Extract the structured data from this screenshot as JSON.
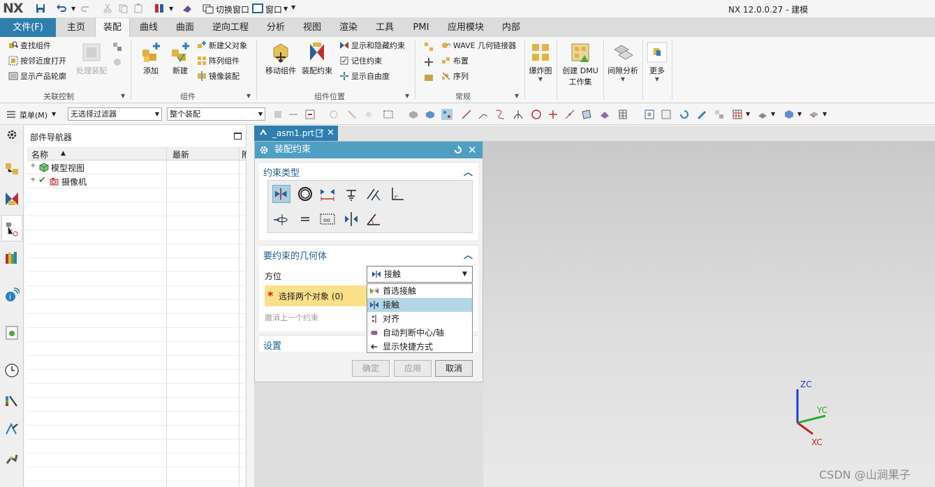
{
  "app": {
    "logo": "NX",
    "title": "NX 12.0.0.27 - 建模",
    "switch_window": "切换窗口",
    "window_menu": "窗口"
  },
  "tabs": [
    "文件(F)",
    "主页",
    "装配",
    "曲线",
    "曲面",
    "逆向工程",
    "分析",
    "视图",
    "渲染",
    "工具",
    "PMI",
    "应用模块",
    "内部"
  ],
  "ribbon": {
    "assoc_control": {
      "label": "关联控制",
      "find_component": "查找组件",
      "open_by_proximity": "按邻近度打开",
      "show_product_outline": "显示产品轮廓",
      "process_assembly": "处理装配"
    },
    "component": {
      "label": "组件",
      "add": "添加",
      "new": "新建",
      "new_parent": "新建父对象",
      "array_component": "阵列组件",
      "mirror_assembly": "镜像装配"
    },
    "component_position": {
      "label": "组件位置",
      "move_component": "移动组件",
      "assembly_constraint": "装配约束",
      "show_hide_constraints": "显示和隐藏约束",
      "remember_constraints": "记住约束",
      "show_dof": "显示自由度"
    },
    "general": {
      "label": "常规",
      "wave_linker": "WAVE 几何链接器",
      "arrangement": "布置",
      "sequence": "序列"
    },
    "exploded_view": "爆炸图",
    "create_dmu": "创建 DMU\n工作集",
    "create_dmu_line1": "创建 DMU",
    "create_dmu_line2": "工作集",
    "clearance_analysis": "间隙分析",
    "more": "更多"
  },
  "selection_bar": {
    "menu": "菜单(M)",
    "filter": "无选择过滤器",
    "scope": "整个装配"
  },
  "navigator": {
    "title": "部件导航器",
    "columns": [
      "名称",
      "最新",
      "附"
    ],
    "rows": [
      {
        "label": "模型视图"
      },
      {
        "label": "摄像机"
      }
    ]
  },
  "doc_tab": {
    "label": "_asm1.prt"
  },
  "dialog": {
    "title": "装配约束",
    "constraint_type": "约束类型",
    "geometry_section": "要约束的几何体",
    "orientation_label": "方位",
    "orientation_value": "接触",
    "select_objects": "选择两个对象 (0)",
    "undo_last": "撤消上一个约束",
    "settings": "设置",
    "ok": "确定",
    "apply": "应用",
    "cancel": "取消"
  },
  "orientation_options": [
    {
      "label": "首选接触",
      "icon": "prefer-touch-icon"
    },
    {
      "label": "接触",
      "icon": "touch-icon",
      "selected": true
    },
    {
      "label": "对齐",
      "icon": "align-icon"
    },
    {
      "label": "自动判断中心/轴",
      "icon": "infer-axis-icon"
    },
    {
      "label": "显示快捷方式",
      "icon": "shortcut-icon"
    }
  ],
  "triad": {
    "zc": "ZC",
    "yc": "YC",
    "xc": "XC"
  },
  "watermark": "CSDN @山涧果子",
  "colors": {
    "accent": "#2e7fb0",
    "dialog_title": "#4f9fc5",
    "selected_row": "#b3d7e6",
    "required_field": "#fbe08a"
  }
}
